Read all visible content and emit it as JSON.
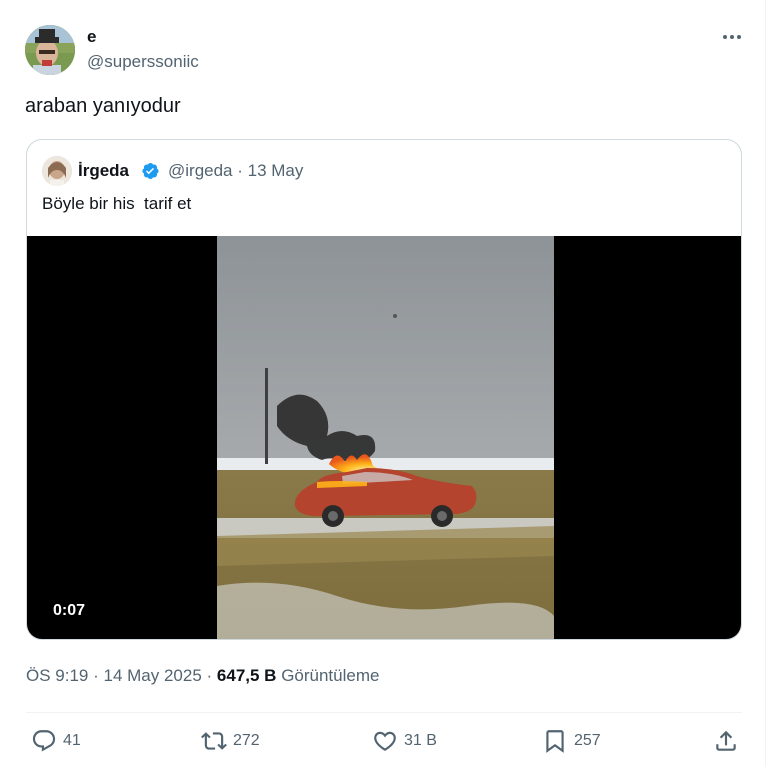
{
  "tweet": {
    "author": {
      "display_name": "e",
      "handle": "@superssoniic",
      "avatar_icon": "user-avatar"
    },
    "text": "araban yanıyodur",
    "more_icon": "more-horizontal-icon"
  },
  "quoted_tweet": {
    "author": {
      "display_name": "İrgeda",
      "handle": "@irgeda",
      "verified": true,
      "verified_color": "#1d9bf0"
    },
    "meta": "@irgeda · 13 May",
    "text": "Böyle bir his  tarif et",
    "video": {
      "duration": "0:07"
    }
  },
  "meta": {
    "time": "ÖS 9:19",
    "date": "14 May 2025",
    "separator": "·",
    "views_count": "647,5 B",
    "views_label": "Görüntüleme"
  },
  "actions": {
    "reply": {
      "icon": "reply-icon",
      "count": "41"
    },
    "retweet": {
      "icon": "retweet-icon",
      "count": "272"
    },
    "like": {
      "icon": "heart-icon",
      "count": "31 B"
    },
    "bookmark": {
      "icon": "bookmark-icon",
      "count": "257"
    },
    "share": {
      "icon": "share-icon"
    }
  },
  "colors": {
    "text_primary": "#0f1419",
    "text_secondary": "#536471",
    "border": "#cfd9de",
    "divider": "#eff3f4",
    "verified_blue": "#1d9bf0"
  }
}
